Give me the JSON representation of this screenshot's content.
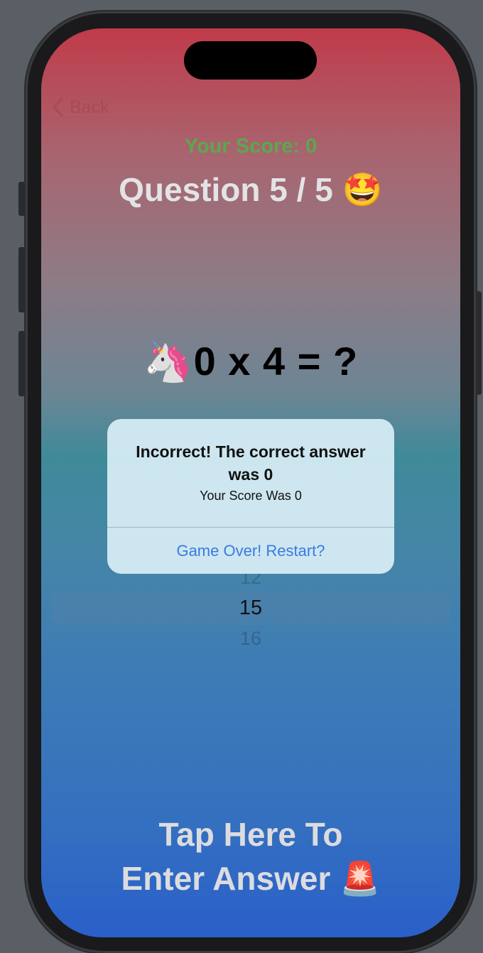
{
  "nav": {
    "back_label": "Back"
  },
  "score": {
    "text": "Your Score: 0"
  },
  "question": {
    "title": "Question 5 / 5 🤩"
  },
  "equation": {
    "emoji": "🦄",
    "text": "0 x 4 = ?"
  },
  "picker": {
    "previous_value": "12",
    "selected_value": "15",
    "next_value": "16"
  },
  "alert": {
    "title": "Incorrect! The correct answer was 0",
    "message": "Your Score Was 0",
    "action_label": "Game Over! Restart?"
  },
  "enter_answer": {
    "line1": "Tap Here To",
    "line2": "Enter Answer 🚨"
  },
  "colors": {
    "score_green": "#5aa84f",
    "alert_action_blue": "#3a7be0",
    "gradient_top": "#c03b4a",
    "gradient_bottom": "#2a5fca"
  }
}
